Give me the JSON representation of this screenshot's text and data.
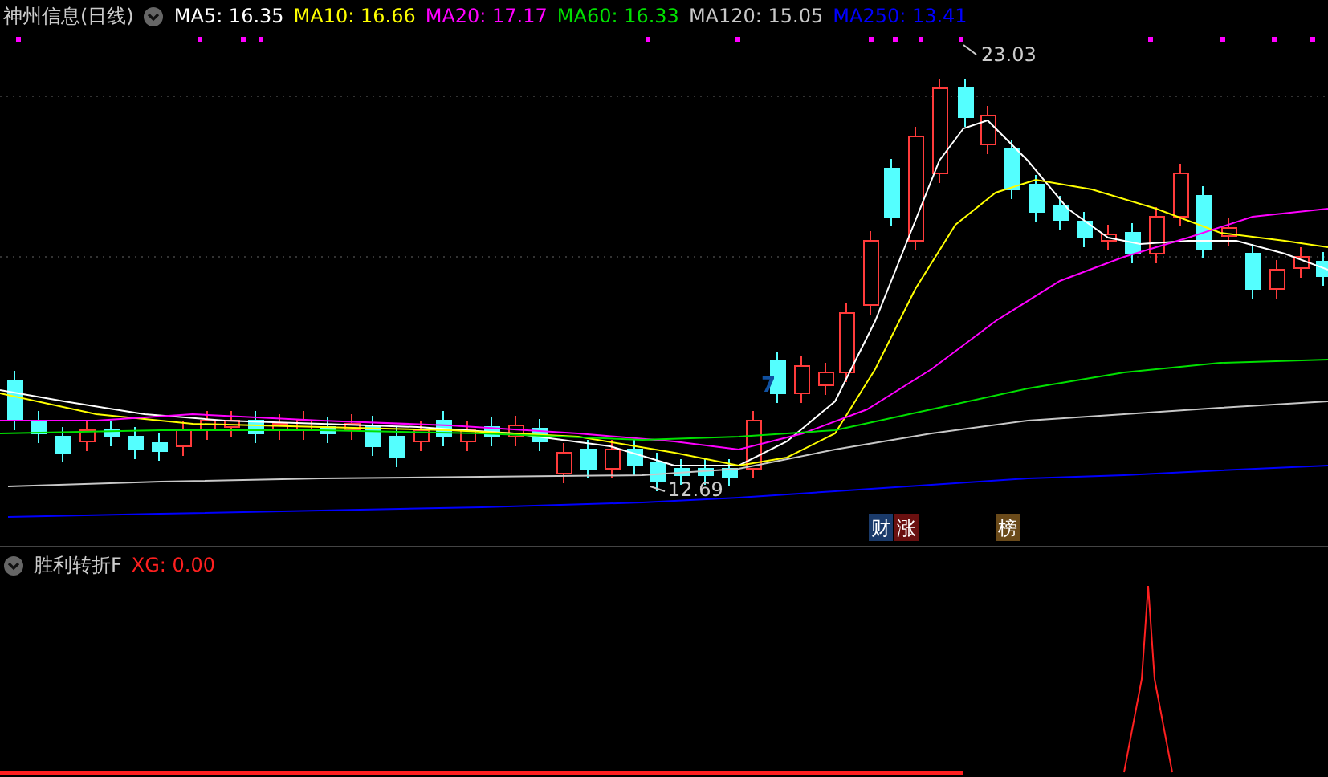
{
  "main_panel": {
    "title": "神州信息(日线)",
    "indicators": [
      {
        "label": "MA5: 16.35",
        "color": "#ffffff"
      },
      {
        "label": "MA10: 16.66",
        "color": "#ffff00"
      },
      {
        "label": "MA20: 17.17",
        "color": "#ff00ff"
      },
      {
        "label": "MA60: 16.33",
        "color": "#00e000"
      },
      {
        "label": "MA120: 15.05",
        "color": "#c8c8c8"
      },
      {
        "label": "MA250: 13.41",
        "color": "#0000ff"
      }
    ],
    "high_label": "23.03",
    "low_label": "12.69",
    "candle_label": "7",
    "event_badges": [
      {
        "label": "财",
        "color": "#1a3a6a"
      },
      {
        "label": "涨",
        "color": "#6a1010"
      },
      {
        "label": "榜",
        "color": "#6a4a1a"
      }
    ]
  },
  "sub_panel": {
    "title": "胜利转折F",
    "indicators": [
      {
        "label": "XG: 0.00",
        "color": "#ff2020"
      }
    ]
  }
}
